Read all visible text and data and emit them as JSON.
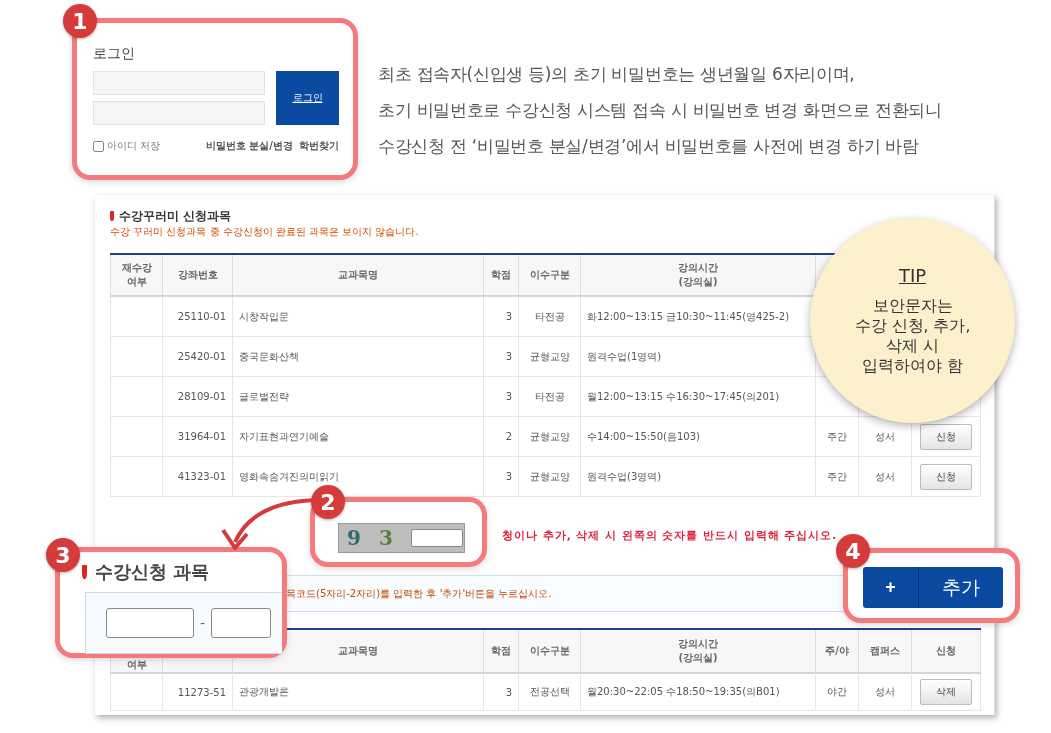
{
  "login_card": {
    "badge": "1",
    "title": "로그인",
    "button": "로그인",
    "remember": {
      "label": "아이디 저장",
      "checked": false
    },
    "links": [
      "비밀번호 분실/변경",
      "학번찾기"
    ]
  },
  "intro_text": [
    "최초 접속자(신입생 등)의 초기 비밀번호는 생년월일 6자리이며,",
    "초기 비밀번호로 수강신청 시스템 접속 시 비밀번호 변경 화면으로 전환되니",
    "수강신청 전 ‘비밀번호 분실/변경’에서 비밀번호를 사전에 변경 하기 바람"
  ],
  "wishlist": {
    "title": "수강꾸러미 신청과목",
    "notice": "수강 꾸러미 신청과목 중 수강신청이 완료된 과목은 보이지 않습니다.",
    "columns": [
      {
        "kind": "label",
        "lines": [
          "재수강",
          "여부"
        ]
      },
      {
        "kind": "label",
        "lines": [
          "강좌번호"
        ]
      },
      {
        "kind": "label",
        "lines": [
          "교과목명"
        ]
      },
      {
        "kind": "label",
        "lines": [
          "학점"
        ]
      },
      {
        "kind": "label",
        "lines": [
          "이수구분"
        ]
      },
      {
        "kind": "label",
        "lines": [
          "강의시간",
          "(강의실)"
        ]
      }
    ],
    "rows": [
      {
        "code": "25110-01",
        "name": "시창작입문",
        "credits": "3",
        "category": "타전공",
        "time": "화12:00~13:15 금10:30~11:45(영425-2)"
      },
      {
        "code": "25420-01",
        "name": "중국문화산책",
        "credits": "3",
        "category": "균형교양",
        "time": "원격수업(1영역)"
      },
      {
        "code": "28109-01",
        "name": "글로벌전략",
        "credits": "3",
        "category": "타전공",
        "time": "월12:00~13:15 수16:30~17:45(의201)"
      },
      {
        "code": "31964-01",
        "name": "자기표현과연기예술",
        "credits": "2",
        "category": "균형교양",
        "time": "수14:00~15:50(음103)",
        "shift": "주간",
        "campus": "성서",
        "action": "신청"
      },
      {
        "code": "41323-01",
        "name": "영화속숨겨진의미읽기",
        "credits": "3",
        "category": "균형교양",
        "time": "원격수업(3영역)",
        "shift": "주간",
        "campus": "성서",
        "action": "신청"
      }
    ]
  },
  "captcha": {
    "badge": "2",
    "digits": [
      "9",
      "3"
    ],
    "notice": "청이나 추가, 삭제 시 왼쪽의 숫자를 반드시 입력해 주십시오."
  },
  "registration": {
    "badge": "3",
    "title": "수강신청 과목",
    "separator": "-",
    "hint": "목코드(5자리-2자리)를 입력한 후 '추가'버튼을 누르십시오.",
    "add_badge": "4",
    "add_button": {
      "icon": "+",
      "label": "추가"
    },
    "columns": [
      {
        "kind": "label",
        "lines": [
          "여부"
        ]
      },
      {
        "kind": "covered"
      },
      {
        "kind": "label",
        "lines": [
          "교과목명"
        ]
      },
      {
        "kind": "label",
        "lines": [
          "학점"
        ]
      },
      {
        "kind": "label",
        "lines": [
          "이수구분"
        ]
      },
      {
        "kind": "label",
        "lines": [
          "강의시간",
          "(강의실)"
        ]
      },
      {
        "kind": "label",
        "lines": [
          "주/야"
        ]
      },
      {
        "kind": "label",
        "lines": [
          "캠퍼스"
        ]
      },
      {
        "kind": "label",
        "lines": [
          "신청"
        ]
      }
    ],
    "rows": [
      {
        "code": "11273-51",
        "name": "관광개발론",
        "credits": "3",
        "category": "전공선택",
        "time": "월20:30~22:05 수18:50~19:35(의B01)",
        "shift": "야간",
        "campus": "성서",
        "action": "삭제"
      }
    ]
  },
  "tip": {
    "title": "TIP",
    "lines": [
      "보안문자는",
      "수강 신청, 추가,",
      "삭제 시",
      "입력하여야 함"
    ]
  }
}
